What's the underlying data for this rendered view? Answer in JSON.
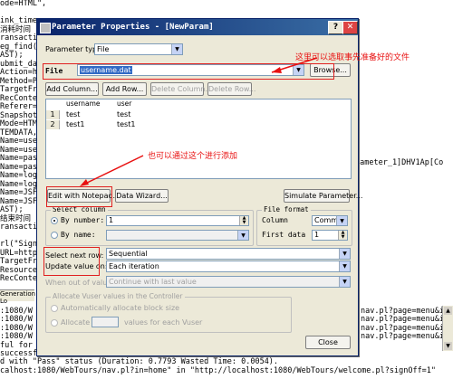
{
  "editor_lines_left": [
    "ode=HTML\",",
    "",
    "ink_time",
    "消耗时间",
    "ransacti",
    "eg_find(",
    "AST);",
    "ubmit_da",
    "Action=h",
    "Method=P",
    "TargetFr",
    "RecConte",
    "Referer=",
    "Snapshot",
    "Mode=HTM",
    "TEMDATA,",
    "Name=use",
    "Name=use",
    "Name=pas",
    "Name=pas",
    "Name=log",
    "Name=log",
    "Name=JSF",
    "Name=JSF",
    "AST);",
    "结束时间",
    "ransacti",
    "",
    "rl(\"Sign",
    "URL=http",
    "TargetFr",
    "Resource",
    "RecConte"
  ],
  "editor_right_text": "rameter_1]DHV1Ap[Co",
  "log_tab_label": "Generation Lo",
  "bottom_lines": [
    ":1080/W",
    ":1080/W",
    ":1080/W",
    ":1080/W",
    "ful for",
    "successful, 1698 body bytes, 1495 header bytes   [MsgId: MMSG-26386]",
    "d with \"Pass\" status (Duration: 0.7793 Wasted Time: 0.0054).",
    "calhost:1080/WebTours/nav.pl?in=home\" in \"http://localhost:1080/WebTours/welcome.pl?signOff=1\""
  ],
  "bottom_right_lines": [
    "nav.pl?page=menu&in=",
    "nav.pl?page=menu&in=",
    "nav.pl?page=menu&in=",
    "nav.pl?page=menu&in="
  ],
  "dialog": {
    "title": "Parameter Properties - [NewParam]",
    "help_btn": "?",
    "close_btn": "✕",
    "param_type_label": "Parameter type:",
    "param_type_value": "File",
    "file_label": "File",
    "file_value": "username.dat",
    "browse_btn": "Browse...",
    "add_column_btn": "Add Column...",
    "add_row_btn": "Add Row...",
    "delete_column_btn": "Delete Column...",
    "delete_row_btn": "Delete Row...",
    "grid_headers": [
      "username",
      "user"
    ],
    "grid_rows": [
      {
        "n": "1",
        "c1": "test",
        "c2": "test"
      },
      {
        "n": "2",
        "c1": "test1",
        "c2": "test1"
      }
    ],
    "edit_notepad_btn": "Edit with Notepad...",
    "data_wizard_btn": "Data Wizard...",
    "simulate_btn": "Simulate Parameter...",
    "select_column_title": "Select column",
    "by_number_label": "By number:",
    "by_number_value": "1",
    "by_name_label": "By name:",
    "file_format_title": "File format",
    "column_label": "Column",
    "column_value": "Comma",
    "first_data_label": "First data",
    "first_data_value": "1",
    "select_next_row_label": "Select next row:",
    "select_next_row_value": "Sequential",
    "update_value_on_label": "Update value on:",
    "update_value_on_value": "Each iteration",
    "when_out_of_values_label": "When out of values:",
    "when_out_of_values_value": "Continue with last value",
    "allocate_title": "Allocate Vuser values in the Controller",
    "auto_allocate_label": "Automatically allocate block size",
    "allocate_label": "Allocate",
    "values_for_each_label": "values for each Vuser",
    "close_btn_label": "Close"
  },
  "annotations": {
    "top": "这里可以选取事先准备好的文件",
    "middle": "也可以通过这个进行添加"
  },
  "colors": {
    "annotation_red": "#e81010",
    "title_bar": "#0a246a"
  }
}
